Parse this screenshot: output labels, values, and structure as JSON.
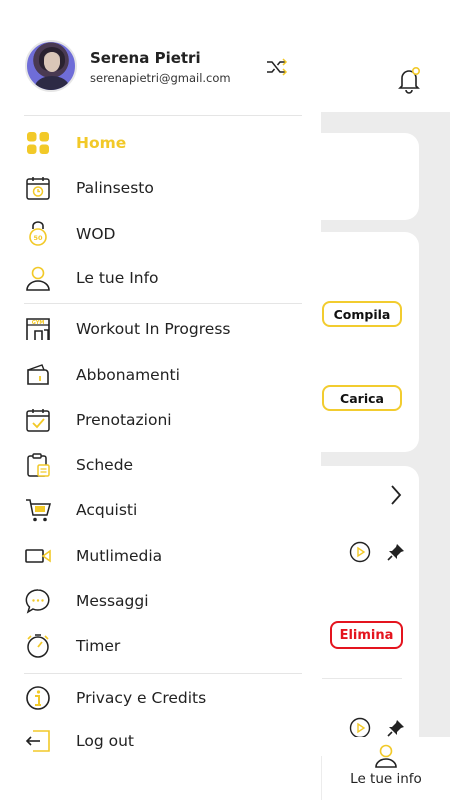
{
  "colors": {
    "accent": "#f2c928",
    "danger": "#e4141e",
    "text": "#222222"
  },
  "profile": {
    "name": "Serena Pietri",
    "email": "serenapietri@gmail.com"
  },
  "menu": {
    "items": [
      {
        "label": "Home",
        "icon": "home-grid-icon",
        "active": true
      },
      {
        "label": "Palinsesto",
        "icon": "calendar-clock-icon"
      },
      {
        "label": "WOD",
        "icon": "kettlebell-icon"
      },
      {
        "label": "Le tue Info",
        "icon": "user-icon"
      },
      {
        "label": "Workout In Progress",
        "icon": "gym-icon"
      },
      {
        "label": "Abbonamenti",
        "icon": "wallet-icon"
      },
      {
        "label": "Prenotazioni",
        "icon": "calendar-check-icon"
      },
      {
        "label": "Schede",
        "icon": "clipboard-icon"
      },
      {
        "label": "Acquisti",
        "icon": "cart-icon"
      },
      {
        "label": "Mutlimedia",
        "icon": "video-icon"
      },
      {
        "label": "Messaggi",
        "icon": "chat-icon"
      },
      {
        "label": "Timer",
        "icon": "timer-icon"
      },
      {
        "label": "Privacy e Credits",
        "icon": "info-icon"
      },
      {
        "label": "Log out",
        "icon": "logout-icon"
      }
    ]
  },
  "background": {
    "compila_label": "Compila",
    "carica_label": "Carica",
    "elimina_label": "Elimina",
    "tab_label": "Le tue info"
  }
}
